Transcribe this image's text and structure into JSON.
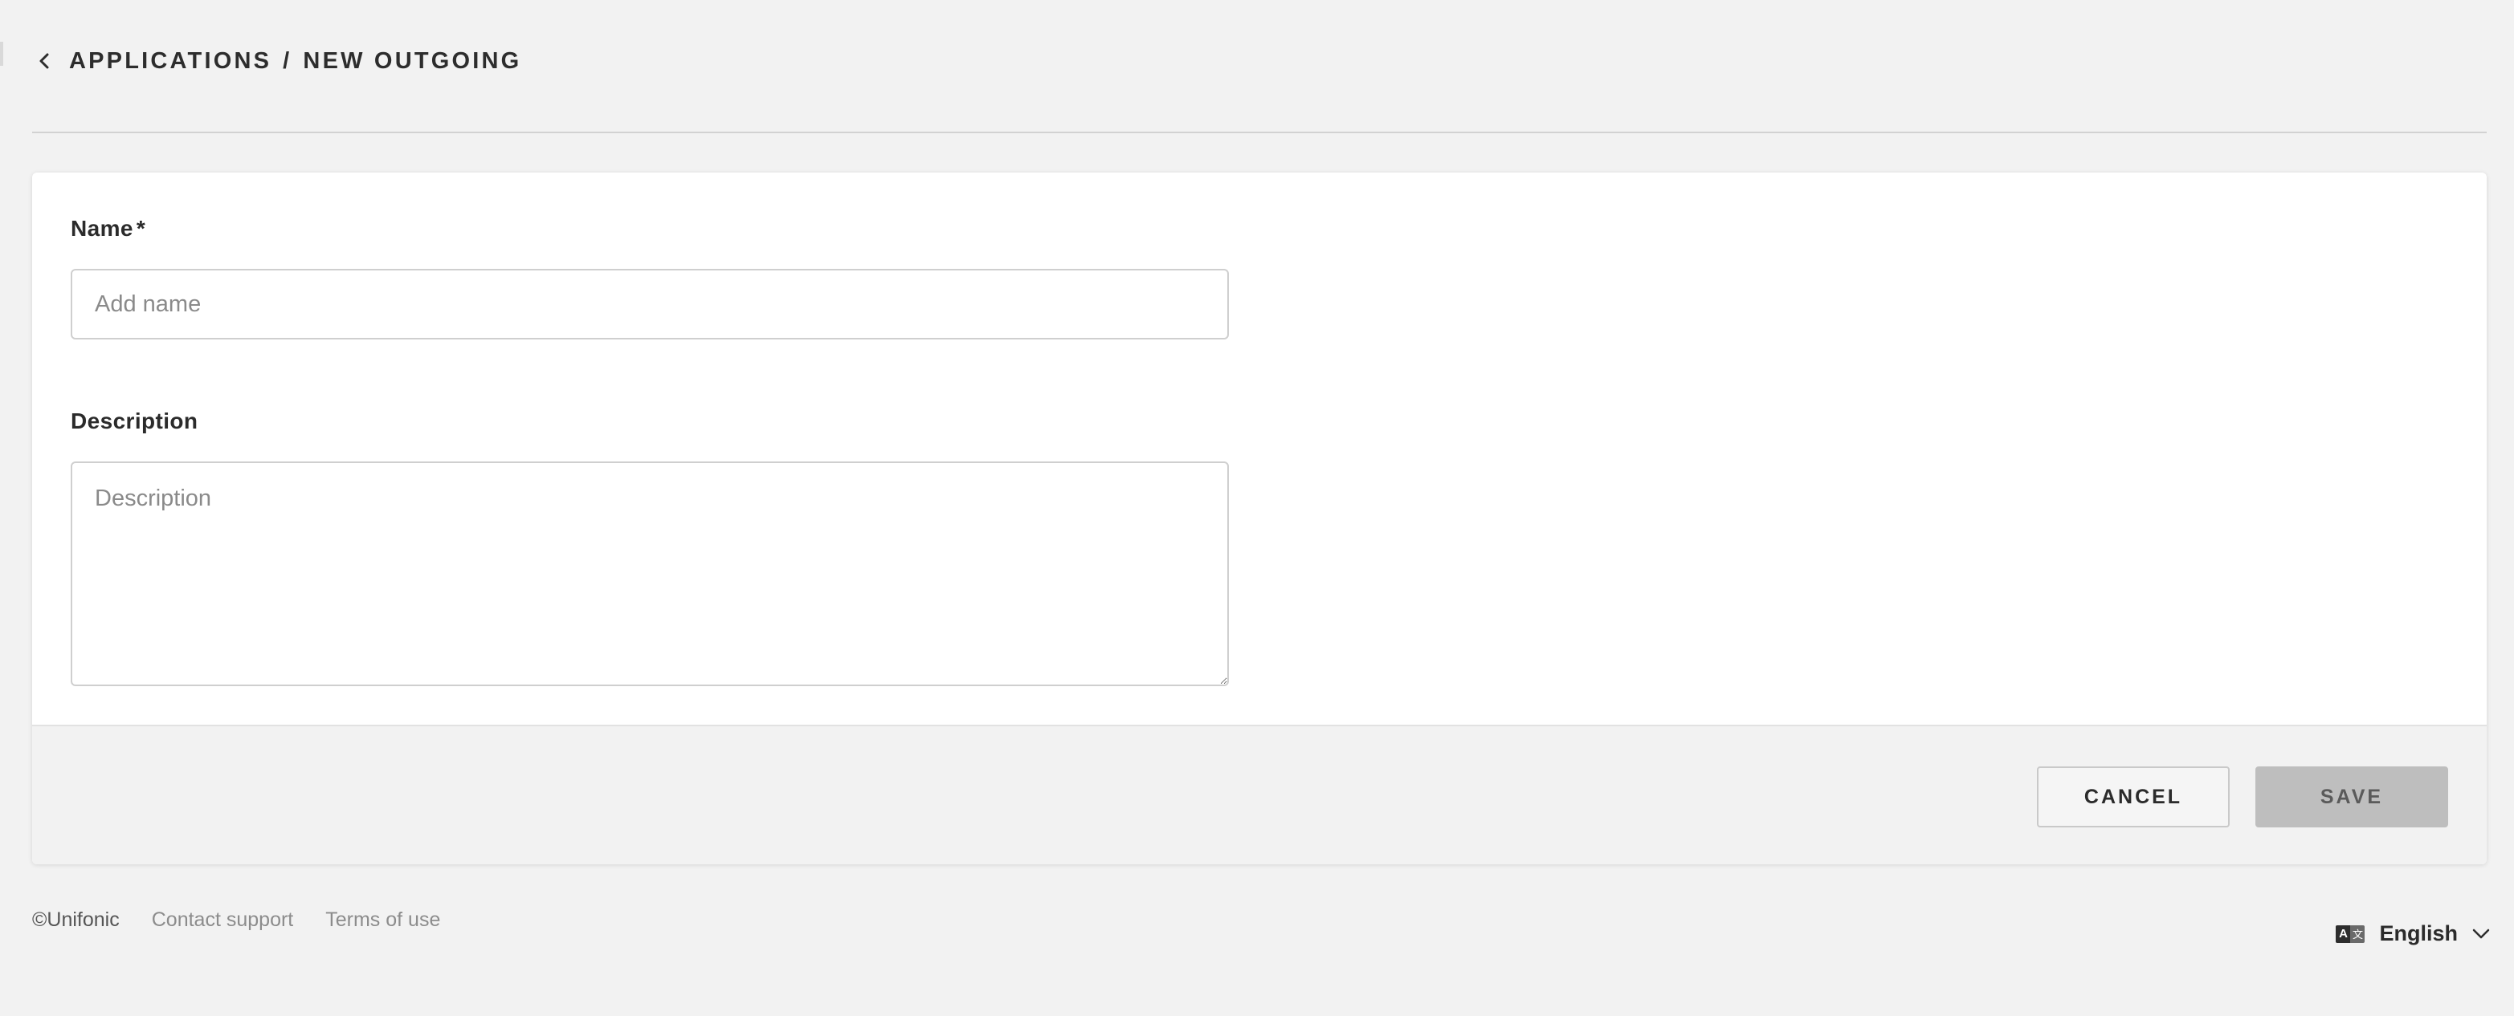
{
  "header": {
    "back_icon": "chevron-left-icon",
    "breadcrumb": {
      "parent": "APPLICATIONS",
      "separator": "/",
      "current": "NEW OUTGOING"
    }
  },
  "form": {
    "name": {
      "label": "Name",
      "required_marker": "*",
      "value": "",
      "placeholder": "Add name"
    },
    "description": {
      "label": "Description",
      "value": "",
      "placeholder": "Description"
    }
  },
  "actions": {
    "cancel_label": "CANCEL",
    "save_label": "SAVE",
    "save_enabled": false
  },
  "footer": {
    "copyright": "©Unifonic",
    "links": [
      "Contact support",
      "Terms of use"
    ],
    "language": {
      "icon": "translate-icon",
      "label": "English",
      "chevron": "chevron-down-icon"
    }
  },
  "colors": {
    "page_background": "#f2f2f2",
    "card_background": "#ffffff",
    "save_disabled": "#bebebe",
    "text_primary": "#2b2b2b",
    "link_muted": "#8c8c8c"
  }
}
